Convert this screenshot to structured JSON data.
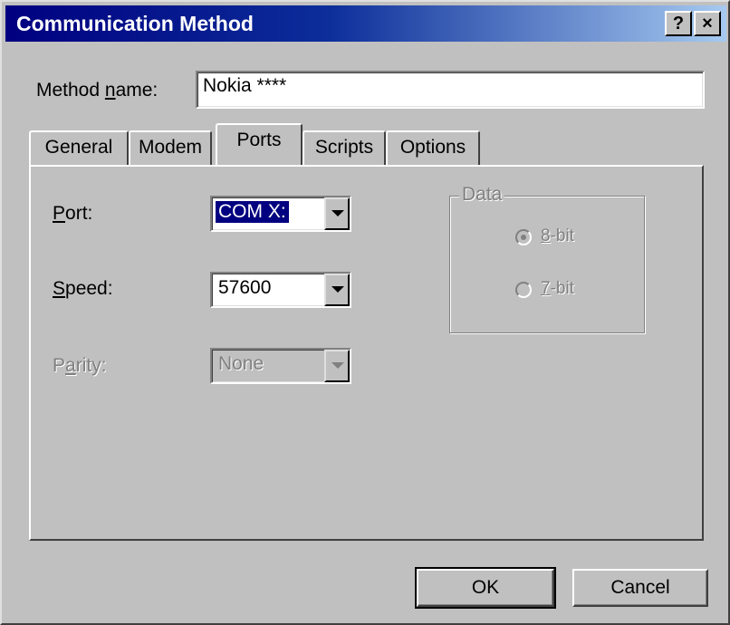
{
  "window": {
    "title": "Communication Method",
    "help_button": "?",
    "close_button": "×"
  },
  "method_name": {
    "label_prefix": "Method ",
    "label_accel": "n",
    "label_suffix": "ame:",
    "value": "Nokia ****"
  },
  "tabs": [
    {
      "label": "General"
    },
    {
      "label": "Modem"
    },
    {
      "label": "Ports",
      "active": true
    },
    {
      "label": "Scripts"
    },
    {
      "label": "Options"
    }
  ],
  "ports": {
    "port": {
      "label_accel": "P",
      "label_rest": "ort:",
      "value": "COM X:"
    },
    "speed": {
      "label_accel": "S",
      "label_rest": "peed:",
      "value": "57600"
    },
    "parity": {
      "label_prefix": "P",
      "label_accel": "a",
      "label_rest": "rity:",
      "value": "None",
      "enabled": false
    }
  },
  "data_group": {
    "title": "Data",
    "options": [
      {
        "accel": "8",
        "rest": "-bit",
        "selected": true
      },
      {
        "accel": "7",
        "rest": "-bit",
        "selected": false
      }
    ]
  },
  "buttons": {
    "ok": "OK",
    "cancel": "Cancel"
  },
  "colors": {
    "titlebar_start": "#000080",
    "titlebar_end": "#a6caf0",
    "face": "#c0c0c0",
    "selection": "#000080"
  }
}
